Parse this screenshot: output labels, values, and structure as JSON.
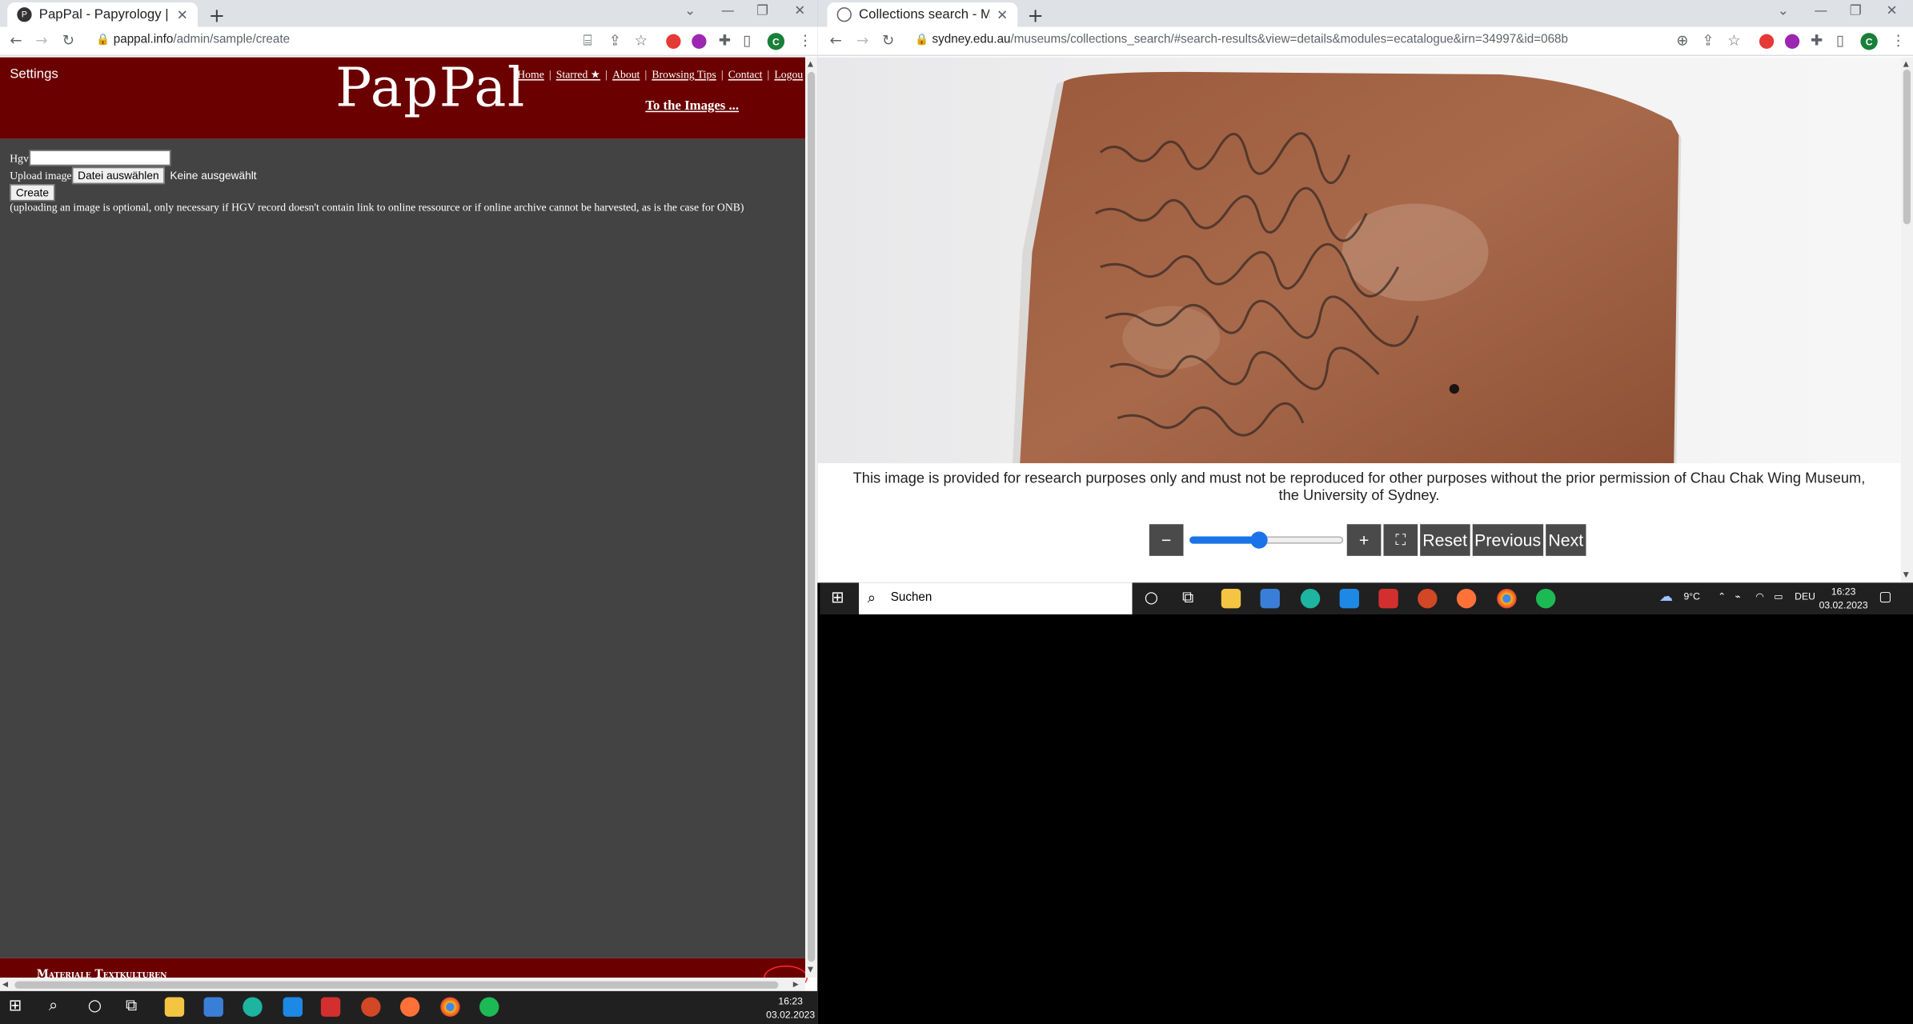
{
  "colors": {
    "pappal_header": "#6b0000",
    "pappal_body": "#434343",
    "chrome_tabstrip": "#dee1e6",
    "taskbar": "#202020",
    "viewer_button": "#4a4a4a",
    "slider_accent": "#1a73e8"
  },
  "left_browser": {
    "tab_title": "PapPal - Papyrology | Paleograph",
    "tab_icon": "pappal-favicon",
    "url_host": "pappal.info",
    "url_path": "/admin/sample/create"
  },
  "pappal": {
    "settings_label": "Settings",
    "logo": "PapPal",
    "nav": {
      "home": "Home",
      "starred": "Starred ★",
      "about": "About",
      "browsing_tips": "Browsing Tips",
      "contact": "Contact",
      "logout": "Logou"
    },
    "images_link": "To the Images ...",
    "form": {
      "hgv_label": "Hgv",
      "hgv_value": "",
      "upload_label": "Upload image",
      "choose_file_button": "Datei auswählen",
      "no_file_text": "Keine ausgewählt",
      "create_button": "Create",
      "note": "(uploading an image is optional, only necessary if HGV record doesn't contain link to online ressource or if online archive cannot be harvested, as is the case for ONB)"
    },
    "footer_text": "Materiale Textkulturen"
  },
  "right_browser": {
    "tab_title": "Collections search - Museums - T",
    "tab_icon": "globe-icon",
    "url_host": "sydney.edu.au",
    "url_path": "/museums/collections_search/#search-results&view=details&modules=ecatalogue&irn=34997&id=068b"
  },
  "viewer": {
    "disclaimer": "This image is provided for research purposes only and must not be reproduced for other purposes without the prior permission of Chau Chak Wing Museum, the University of Sydney.",
    "zoom_out": "−",
    "zoom_in": "+",
    "fit_icon": "⛶",
    "reset": "Reset",
    "previous": "Previous",
    "next": "Next",
    "zoom_level": 0.45
  },
  "taskbar_left": {
    "time": "16:23",
    "date": "03.02.2023"
  },
  "taskbar_right": {
    "search_placeholder": "Suchen",
    "weather": "9°C",
    "language": "DEU",
    "time": "16:23",
    "date": "03.02.2023"
  }
}
